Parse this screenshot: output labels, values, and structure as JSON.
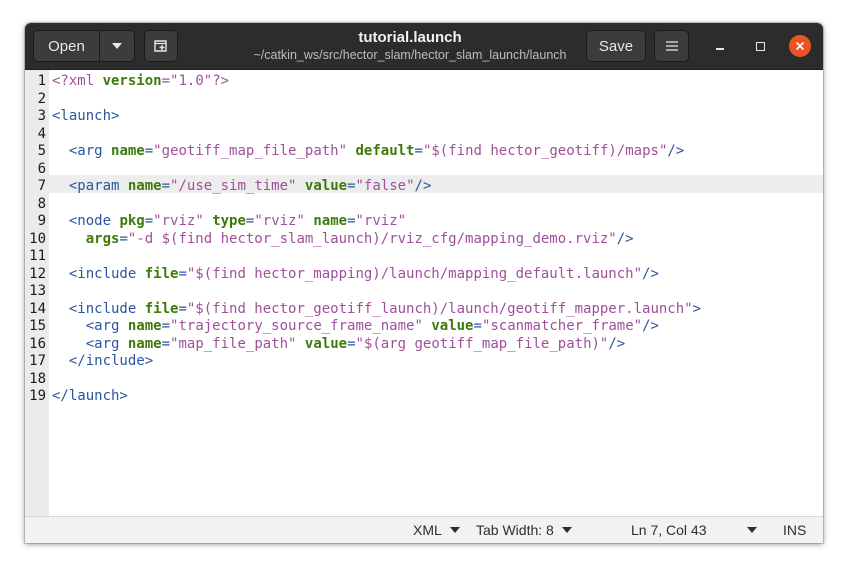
{
  "window": {
    "title": "tutorial.launch",
    "subtitle": "~/catkin_ws/src/hector_slam/hector_slam_launch/launch"
  },
  "headerbar": {
    "open_label": "Open",
    "save_label": "Save"
  },
  "editor": {
    "current_line": 7,
    "lines": [
      {
        "n": "1",
        "segs": [
          [
            "pi",
            "<?xml "
          ],
          [
            "attr",
            "version"
          ],
          [
            "pi",
            "="
          ],
          [
            "str",
            "\"1.0\""
          ],
          [
            "pi",
            "?>"
          ]
        ]
      },
      {
        "n": "2",
        "segs": []
      },
      {
        "n": "3",
        "segs": [
          [
            "tag",
            "<launch>"
          ]
        ]
      },
      {
        "n": "4",
        "segs": []
      },
      {
        "n": "5",
        "segs": [
          [
            "",
            "  "
          ],
          [
            "tag",
            "<arg "
          ],
          [
            "attr",
            "name"
          ],
          [
            "tag",
            "="
          ],
          [
            "str",
            "\"geotiff_map_file_path\""
          ],
          [
            "tag",
            " "
          ],
          [
            "attr",
            "default"
          ],
          [
            "tag",
            "="
          ],
          [
            "str",
            "\"$(find hector_geotiff)/maps\""
          ],
          [
            "tag",
            "/>"
          ]
        ]
      },
      {
        "n": "6",
        "segs": []
      },
      {
        "n": "7",
        "segs": [
          [
            "",
            "  "
          ],
          [
            "tag",
            "<param "
          ],
          [
            "attr",
            "name"
          ],
          [
            "tag",
            "="
          ],
          [
            "str",
            "\"/use_sim_time\""
          ],
          [
            "tag",
            " "
          ],
          [
            "attr",
            "value"
          ],
          [
            "tag",
            "="
          ],
          [
            "str",
            "\"false\""
          ],
          [
            "tag",
            "/>"
          ]
        ]
      },
      {
        "n": "8",
        "segs": []
      },
      {
        "n": "9",
        "segs": [
          [
            "",
            "  "
          ],
          [
            "tag",
            "<node "
          ],
          [
            "attr",
            "pkg"
          ],
          [
            "tag",
            "="
          ],
          [
            "str",
            "\"rviz\""
          ],
          [
            "tag",
            " "
          ],
          [
            "attr",
            "type"
          ],
          [
            "tag",
            "="
          ],
          [
            "str",
            "\"rviz\""
          ],
          [
            "tag",
            " "
          ],
          [
            "attr",
            "name"
          ],
          [
            "tag",
            "="
          ],
          [
            "str",
            "\"rviz\""
          ]
        ]
      },
      {
        "n": "10",
        "segs": [
          [
            "",
            "    "
          ],
          [
            "attr",
            "args"
          ],
          [
            "tag",
            "="
          ],
          [
            "str",
            "\"-d $(find hector_slam_launch)/rviz_cfg/mapping_demo.rviz\""
          ],
          [
            "tag",
            "/>"
          ]
        ]
      },
      {
        "n": "11",
        "segs": []
      },
      {
        "n": "12",
        "segs": [
          [
            "",
            "  "
          ],
          [
            "tag",
            "<include "
          ],
          [
            "attr",
            "file"
          ],
          [
            "tag",
            "="
          ],
          [
            "str",
            "\"$(find hector_mapping)/launch/mapping_default.launch\""
          ],
          [
            "tag",
            "/>"
          ]
        ]
      },
      {
        "n": "13",
        "segs": []
      },
      {
        "n": "14",
        "segs": [
          [
            "",
            "  "
          ],
          [
            "tag",
            "<include "
          ],
          [
            "attr",
            "file"
          ],
          [
            "tag",
            "="
          ],
          [
            "str",
            "\"$(find hector_geotiff_launch)/launch/geotiff_mapper.launch\""
          ],
          [
            "tag",
            ">"
          ]
        ]
      },
      {
        "n": "15",
        "segs": [
          [
            "",
            "    "
          ],
          [
            "tag",
            "<arg "
          ],
          [
            "attr",
            "name"
          ],
          [
            "tag",
            "="
          ],
          [
            "str",
            "\"trajectory_source_frame_name\""
          ],
          [
            "tag",
            " "
          ],
          [
            "attr",
            "value"
          ],
          [
            "tag",
            "="
          ],
          [
            "str",
            "\"scanmatcher_frame\""
          ],
          [
            "tag",
            "/>"
          ]
        ]
      },
      {
        "n": "16",
        "segs": [
          [
            "",
            "    "
          ],
          [
            "tag",
            "<arg "
          ],
          [
            "attr",
            "name"
          ],
          [
            "tag",
            "="
          ],
          [
            "str",
            "\"map_file_path\""
          ],
          [
            "tag",
            " "
          ],
          [
            "attr",
            "value"
          ],
          [
            "tag",
            "="
          ],
          [
            "str",
            "\"$(arg geotiff_map_file_path)\""
          ],
          [
            "tag",
            "/>"
          ]
        ]
      },
      {
        "n": "17",
        "segs": [
          [
            "",
            "  "
          ],
          [
            "tag",
            "</include>"
          ]
        ]
      },
      {
        "n": "18",
        "segs": []
      },
      {
        "n": "19",
        "segs": [
          [
            "tag",
            "</launch>"
          ]
        ]
      }
    ]
  },
  "statusbar": {
    "language": "XML",
    "tab_width": "Tab Width: 8",
    "position": "Ln 7, Col 43",
    "mode": "INS"
  },
  "icons": {
    "open_dropdown": "chevron-down-icon",
    "new_tab": "new-tab-icon",
    "menu": "hamburger-menu-icon",
    "minimize": "minimize-icon",
    "maximize": "maximize-icon",
    "close": "close-icon"
  },
  "colors": {
    "headerbar": "#2c2c2c",
    "close_button": "#e95420",
    "xml_tag": "#2a55a0",
    "xml_attribute": "#3d7a0a",
    "xml_string": "#a0509b"
  }
}
